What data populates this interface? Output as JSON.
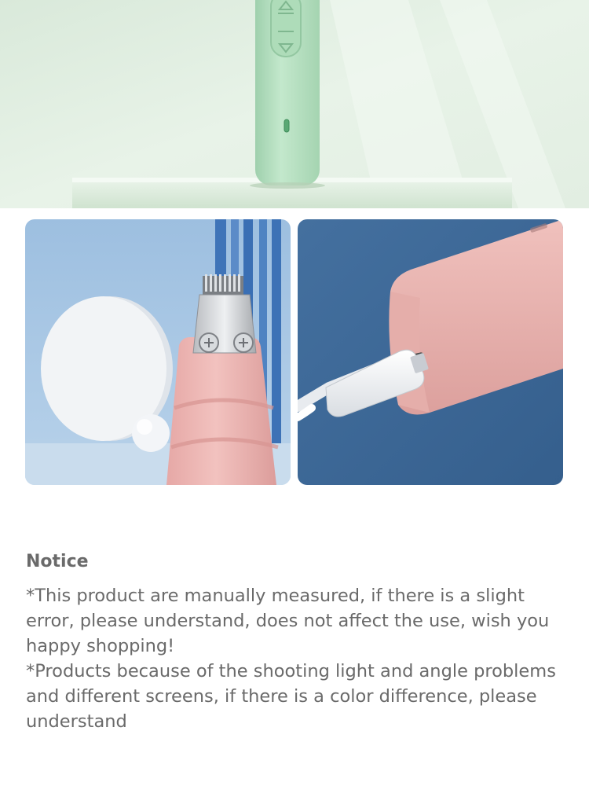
{
  "notice": {
    "title": "Notice",
    "lines": [
      "*This product are manually measured, if there is a slight error, please understand, does not affect the use, wish you happy shopping!",
      "*Products because of the shooting light and angle problems and different screens, if there is a color difference, please understand"
    ]
  },
  "images": {
    "hero": "green-trimmer-on-pedestal-image",
    "gallery": [
      "pink-trimmer-blade-image",
      "pink-trimmer-usb-charging-image"
    ]
  },
  "colors": {
    "hero_bg": "#e6f1e6",
    "trimmer_green": "#b9e2c3",
    "left_bg": "#a9c7e4",
    "trimmer_pink": "#e9b1ae",
    "right_bg": "#3f6896",
    "notice_text": "#6a6a6a"
  }
}
